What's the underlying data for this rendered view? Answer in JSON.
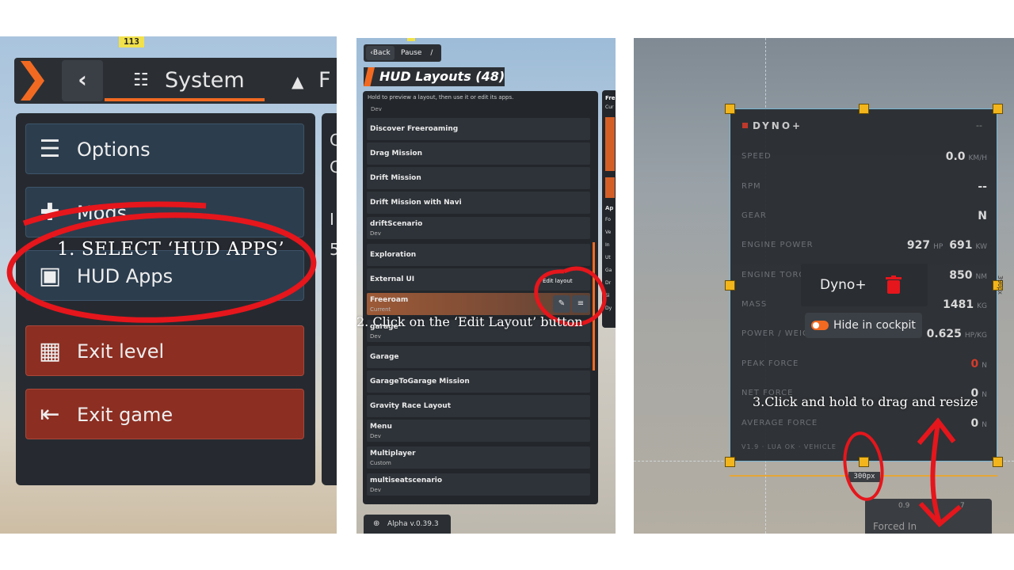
{
  "panel1": {
    "counter": "113",
    "nav": {
      "back_icon": "chevron-left",
      "current_tab": "System",
      "next_tab_partial": "F"
    },
    "menu": [
      {
        "label": "Options",
        "icon": "sliders-icon",
        "style": "blue"
      },
      {
        "label": "Mods",
        "icon": "puzzle-icon",
        "style": "blue"
      },
      {
        "label": "HUD Apps",
        "icon": "hud-icon",
        "style": "blue"
      },
      {
        "label": "Exit level",
        "icon": "exit-level-icon",
        "style": "red"
      },
      {
        "label": "Exit game",
        "icon": "exit-game-icon",
        "style": "red"
      }
    ],
    "side_glyphs": [
      "C",
      "C",
      "I",
      "5"
    ],
    "annotation": "1. SELECT ‘HUD APPS’"
  },
  "panel2": {
    "header": {
      "back": "Back",
      "pause": "Pause"
    },
    "title": "HUD Layouts (48)",
    "hint": "Hold to preview a layout, then use it or edit its apps.",
    "hint_sub": "Dev",
    "layouts": [
      {
        "name": "Discover Freeroaming",
        "sub": ""
      },
      {
        "name": "Drag Mission",
        "sub": ""
      },
      {
        "name": "Drift Mission",
        "sub": ""
      },
      {
        "name": "Drift Mission with Navi",
        "sub": ""
      },
      {
        "name": "driftScenario",
        "sub": "Dev"
      },
      {
        "name": "Exploration",
        "sub": ""
      },
      {
        "name": "External UI",
        "sub": ""
      },
      {
        "name": "Freeroam",
        "sub": "Current"
      },
      {
        "name": "garage",
        "sub": "Dev"
      },
      {
        "name": "Garage",
        "sub": ""
      },
      {
        "name": "GarageToGarage Mission",
        "sub": ""
      },
      {
        "name": "Gravity Race Layout",
        "sub": ""
      },
      {
        "name": "Menu",
        "sub": "Dev"
      },
      {
        "name": "Multiplayer",
        "sub": "Custom"
      },
      {
        "name": "multiseatscenario",
        "sub": "Dev"
      }
    ],
    "edit_tooltip": "Edit layout",
    "side_panel": {
      "title": "Fre",
      "sub": "Cur",
      "section": "Ap",
      "items": [
        "Fo",
        "Ve",
        "In",
        "Ut",
        "Ga",
        "Dr",
        "Si",
        "Dy"
      ]
    },
    "version": "Alpha v.0.39.3",
    "annotation": "2. Click on the ‘Edit Layout’ button"
  },
  "panel3": {
    "widget_title": "DYNO+",
    "title_right": "--",
    "rows": [
      {
        "label": "SPEED",
        "value": "0.0",
        "unit": "KM/H"
      },
      {
        "label": "RPM",
        "value": "--",
        "unit": ""
      },
      {
        "label": "GEAR",
        "value": "N",
        "unit": ""
      },
      {
        "label": "ENGINE POWER",
        "value": "927",
        "unit": "HP",
        "value2": "691",
        "unit2": "KW"
      },
      {
        "label": "ENGINE TORQUE",
        "value": "850",
        "unit": "NM"
      },
      {
        "label": "MASS",
        "value": "1481",
        "unit": "KG"
      },
      {
        "label": "POWER / WEIGHT",
        "value": "0.625",
        "unit": "HP/KG"
      },
      {
        "label": "PEAK FORCE",
        "value": "0",
        "unit": "N",
        "red": true
      },
      {
        "label": "NET FORCE",
        "value": "0",
        "unit": "N"
      },
      {
        "label": "AVERAGE FORCE",
        "value": "0",
        "unit": "N"
      }
    ],
    "footer": "V1.9 · LUA OK · VEHICLE",
    "popup": {
      "name": "Dyno+",
      "hide": "Hide in cockpit"
    },
    "width_label": "300px",
    "height_label": "390px",
    "under_widget": {
      "left": "0.9",
      "right": "7",
      "bottom": "Forced In"
    },
    "annotation": "3.Click and hold to drag and resize"
  }
}
